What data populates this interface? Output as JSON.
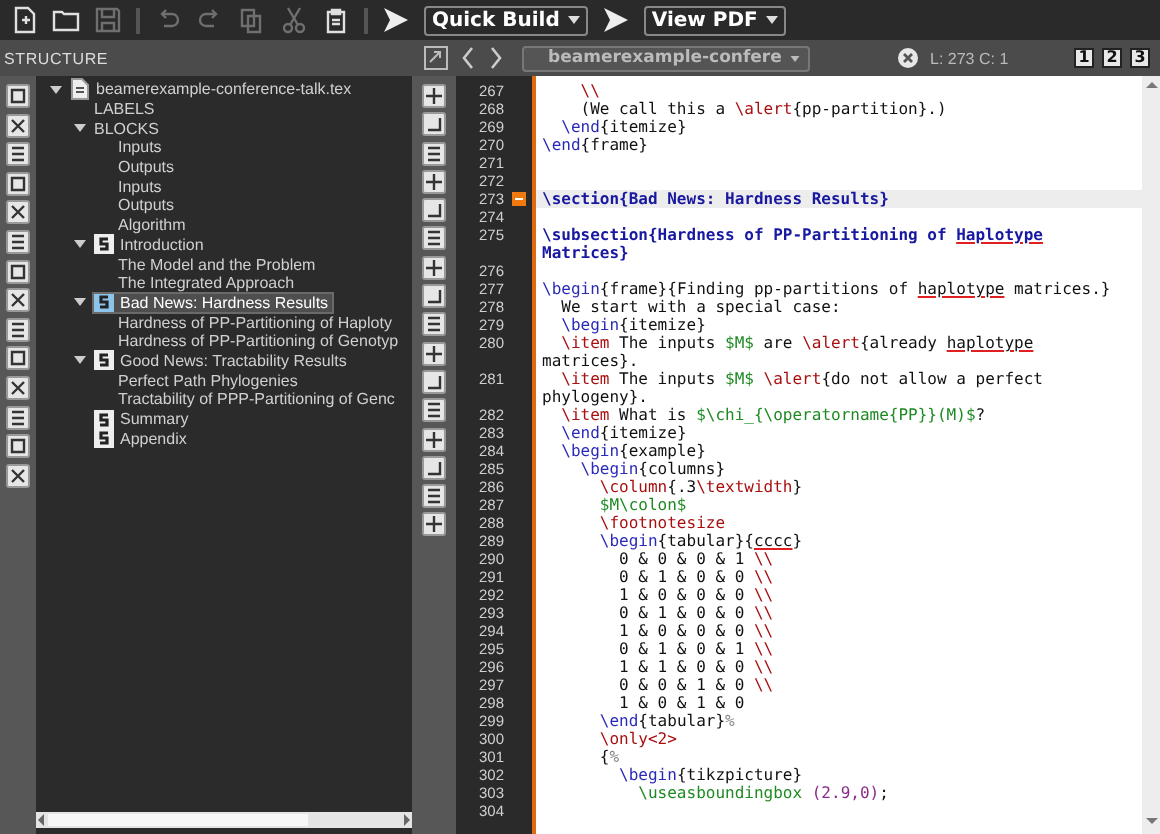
{
  "toolbar": {
    "buttons": [
      {
        "kind": "new",
        "disabled": false
      },
      {
        "kind": "open",
        "disabled": false
      },
      {
        "kind": "save",
        "disabled": true
      },
      {
        "kind": "separator"
      },
      {
        "kind": "undo",
        "disabled": true
      },
      {
        "kind": "redo",
        "disabled": true
      },
      {
        "kind": "copy",
        "disabled": true
      },
      {
        "kind": "cut",
        "disabled": true
      },
      {
        "kind": "paste",
        "disabled": false
      },
      {
        "kind": "separator"
      }
    ],
    "build": {
      "label": "Quick Build"
    },
    "view": {
      "label": "View PDF"
    }
  },
  "structure": {
    "title": "STRUCTURE",
    "tree": [
      {
        "label": "beamerexample-conference-talk.tex",
        "kind": "file",
        "expanded": true,
        "selected": false,
        "children": [
          {
            "label": "LABELS",
            "kind": "plain",
            "selected": false
          },
          {
            "label": "BLOCKS",
            "kind": "plain",
            "expanded": true,
            "selected": false,
            "children": [
              {
                "label": "Inputs",
                "kind": "plain",
                "selected": false
              },
              {
                "label": "Outputs",
                "kind": "plain",
                "selected": false
              },
              {
                "label": "Inputs",
                "kind": "plain",
                "selected": false
              },
              {
                "label": "Outputs",
                "kind": "plain",
                "selected": false
              },
              {
                "label": "Algorithm",
                "kind": "plain",
                "selected": false
              }
            ]
          },
          {
            "label": "Introduction",
            "kind": "section",
            "expanded": true,
            "selected": false,
            "children": [
              {
                "label": "The Model and the Problem",
                "kind": "plain",
                "selected": false
              },
              {
                "label": "The Integrated Approach",
                "kind": "plain",
                "selected": false
              }
            ]
          },
          {
            "label": "Bad News: Hardness Results",
            "kind": "section",
            "expanded": true,
            "selected": true,
            "children": [
              {
                "label": "Hardness of PP-Partitioning of Haploty",
                "kind": "plain",
                "selected": false
              },
              {
                "label": "Hardness of PP-Partitioning of Genotyp",
                "kind": "plain",
                "selected": false
              }
            ]
          },
          {
            "label": "Good News: Tractability Results",
            "kind": "section",
            "expanded": true,
            "selected": false,
            "children": [
              {
                "label": "Perfect Path Phylogenies",
                "kind": "plain",
                "selected": false
              },
              {
                "label": "Tractability of PPP-Partitioning of Genc",
                "kind": "plain",
                "selected": false
              }
            ]
          },
          {
            "label": "Summary",
            "kind": "section",
            "selected": false
          },
          {
            "label": "Appendix",
            "kind": "section",
            "selected": false
          }
        ]
      }
    ]
  },
  "editor": {
    "file_tab": "beamerexample-confere",
    "cursor": "L: 273 C: 1",
    "bookmarks": [
      "1",
      "2",
      "3"
    ],
    "lines": [
      {
        "number": "267",
        "current": false,
        "marker": false,
        "rows": [
          [
            {
              "kind": "cmd",
              "t": "    \\\\"
            }
          ]
        ]
      },
      {
        "number": "268",
        "current": false,
        "marker": false,
        "rows": [
          [
            {
              "kind": "t",
              "t": "    (We call this a "
            },
            {
              "kind": "cmd",
              "t": "\\alert"
            },
            {
              "kind": "t",
              "t": "{pp-partition}.)"
            }
          ]
        ]
      },
      {
        "number": "269",
        "current": false,
        "marker": false,
        "rows": [
          [
            {
              "kind": "env",
              "t": "  \\end"
            },
            {
              "kind": "t",
              "t": "{itemize}"
            }
          ]
        ]
      },
      {
        "number": "270",
        "current": false,
        "marker": false,
        "rows": [
          [
            {
              "kind": "env",
              "t": "\\end"
            },
            {
              "kind": "t",
              "t": "{frame}"
            }
          ]
        ]
      },
      {
        "number": "271",
        "current": false,
        "marker": false
      },
      {
        "number": "272",
        "current": false,
        "marker": false
      },
      {
        "number": "273",
        "current": true,
        "marker": true,
        "rows": [
          [
            {
              "kind": "sec",
              "t": "\\section{Bad News: Hardness Results}"
            }
          ]
        ]
      },
      {
        "number": "274",
        "current": false,
        "marker": false
      },
      {
        "number": "275",
        "current": false,
        "marker": false,
        "rows": [
          [
            {
              "kind": "sec",
              "t": "\\subsection{Hardness of PP-Partitioning of "
            },
            {
              "kind": "secspell",
              "t": "Haplotype"
            }
          ],
          [
            {
              "kind": "sec",
              "t": "Matrices}"
            }
          ]
        ]
      },
      {
        "number": "276",
        "current": false,
        "marker": false
      },
      {
        "number": "277",
        "current": false,
        "marker": false,
        "rows": [
          [
            {
              "kind": "env",
              "t": "\\begin"
            },
            {
              "kind": "t",
              "t": "{frame}{Finding pp-partitions of "
            },
            {
              "kind": "spell",
              "t": "haplotype"
            },
            {
              "kind": "t",
              "t": " matrices.}"
            }
          ]
        ]
      },
      {
        "number": "278",
        "current": false,
        "marker": false,
        "rows": [
          [
            {
              "kind": "t",
              "t": "  We start with a special case:"
            }
          ]
        ]
      },
      {
        "number": "279",
        "current": false,
        "marker": false,
        "rows": [
          [
            {
              "kind": "env",
              "t": "  \\begin"
            },
            {
              "kind": "t",
              "t": "{itemize}"
            }
          ]
        ]
      },
      {
        "number": "280",
        "current": false,
        "marker": false,
        "rows": [
          [
            {
              "kind": "cmd",
              "t": "  \\item"
            },
            {
              "kind": "t",
              "t": " The inputs "
            },
            {
              "kind": "math",
              "t": "$M$"
            },
            {
              "kind": "t",
              "t": " are "
            },
            {
              "kind": "cmd",
              "t": "\\alert"
            },
            {
              "kind": "t",
              "t": "{already "
            },
            {
              "kind": "spell",
              "t": "haplotype"
            }
          ],
          [
            {
              "kind": "t",
              "t": "matrices}."
            }
          ]
        ]
      },
      {
        "number": "281",
        "current": false,
        "marker": false,
        "rows": [
          [
            {
              "kind": "cmd",
              "t": "  \\item"
            },
            {
              "kind": "t",
              "t": " The inputs "
            },
            {
              "kind": "math",
              "t": "$M$"
            },
            {
              "kind": "cmd",
              "t": " \\alert"
            },
            {
              "kind": "t",
              "t": "{do not allow a perfect"
            }
          ],
          [
            {
              "kind": "t",
              "t": "phylogeny}."
            }
          ]
        ]
      },
      {
        "number": "282",
        "current": false,
        "marker": false,
        "rows": [
          [
            {
              "kind": "cmd",
              "t": "  \\item"
            },
            {
              "kind": "t",
              "t": " What is "
            },
            {
              "kind": "math",
              "t": "$\\chi_{\\operatorname{PP}}(M)$"
            },
            {
              "kind": "t",
              "t": "?"
            }
          ]
        ]
      },
      {
        "number": "283",
        "current": false,
        "marker": false,
        "rows": [
          [
            {
              "kind": "env",
              "t": "  \\end"
            },
            {
              "kind": "t",
              "t": "{itemize}"
            }
          ]
        ]
      },
      {
        "number": "284",
        "current": false,
        "marker": false,
        "rows": [
          [
            {
              "kind": "env",
              "t": "  \\begin"
            },
            {
              "kind": "t",
              "t": "{example}"
            }
          ]
        ]
      },
      {
        "number": "285",
        "current": false,
        "marker": false,
        "rows": [
          [
            {
              "kind": "env",
              "t": "    \\begin"
            },
            {
              "kind": "t",
              "t": "{columns}"
            }
          ]
        ]
      },
      {
        "number": "286",
        "current": false,
        "marker": false,
        "rows": [
          [
            {
              "kind": "cmd",
              "t": "      \\column"
            },
            {
              "kind": "t",
              "t": "{.3"
            },
            {
              "kind": "cmd",
              "t": "\\textwidth"
            },
            {
              "kind": "t",
              "t": "}"
            }
          ]
        ]
      },
      {
        "number": "287",
        "current": false,
        "marker": false,
        "rows": [
          [
            {
              "kind": "math",
              "t": "      $M\\colon$"
            }
          ]
        ]
      },
      {
        "number": "288",
        "current": false,
        "marker": false,
        "rows": [
          [
            {
              "kind": "cmd",
              "t": "      \\footnotesize"
            }
          ]
        ]
      },
      {
        "number": "289",
        "current": false,
        "marker": false,
        "rows": [
          [
            {
              "kind": "env",
              "t": "      \\begin"
            },
            {
              "kind": "t",
              "t": "{tabular}{"
            },
            {
              "kind": "spell",
              "t": "cccc"
            },
            {
              "kind": "t",
              "t": "}"
            }
          ]
        ]
      },
      {
        "number": "290",
        "current": false,
        "marker": false,
        "rows": [
          [
            {
              "kind": "t",
              "t": "        0 & 0 & 0 & 1 "
            },
            {
              "kind": "cmd",
              "t": "\\\\"
            }
          ]
        ]
      },
      {
        "number": "291",
        "current": false,
        "marker": false,
        "rows": [
          [
            {
              "kind": "t",
              "t": "        0 & 1 & 0 & 0 "
            },
            {
              "kind": "cmd",
              "t": "\\\\"
            }
          ]
        ]
      },
      {
        "number": "292",
        "current": false,
        "marker": false,
        "rows": [
          [
            {
              "kind": "t",
              "t": "        1 & 0 & 0 & 0 "
            },
            {
              "kind": "cmd",
              "t": "\\\\"
            }
          ]
        ]
      },
      {
        "number": "293",
        "current": false,
        "marker": false,
        "rows": [
          [
            {
              "kind": "t",
              "t": "        0 & 1 & 0 & 0 "
            },
            {
              "kind": "cmd",
              "t": "\\\\"
            }
          ]
        ]
      },
      {
        "number": "294",
        "current": false,
        "marker": false,
        "rows": [
          [
            {
              "kind": "t",
              "t": "        1 & 0 & 0 & 0 "
            },
            {
              "kind": "cmd",
              "t": "\\\\"
            }
          ]
        ]
      },
      {
        "number": "295",
        "current": false,
        "marker": false,
        "rows": [
          [
            {
              "kind": "t",
              "t": "        0 & 1 & 0 & 1 "
            },
            {
              "kind": "cmd",
              "t": "\\\\"
            }
          ]
        ]
      },
      {
        "number": "296",
        "current": false,
        "marker": false,
        "rows": [
          [
            {
              "kind": "t",
              "t": "        1 & 1 & 0 & 0 "
            },
            {
              "kind": "cmd",
              "t": "\\\\"
            }
          ]
        ]
      },
      {
        "number": "297",
        "current": false,
        "marker": false,
        "rows": [
          [
            {
              "kind": "t",
              "t": "        0 & 0 & 1 & 0 "
            },
            {
              "kind": "cmd",
              "t": "\\\\"
            }
          ]
        ]
      },
      {
        "number": "298",
        "current": false,
        "marker": false,
        "rows": [
          [
            {
              "kind": "t",
              "t": "        1 & 0 & 1 & 0"
            }
          ]
        ]
      },
      {
        "number": "299",
        "current": false,
        "marker": false,
        "rows": [
          [
            {
              "kind": "env",
              "t": "      \\end"
            },
            {
              "kind": "t",
              "t": "{tabular}"
            },
            {
              "kind": "cmt",
              "t": "%"
            }
          ]
        ]
      },
      {
        "number": "300",
        "current": false,
        "marker": false,
        "rows": [
          [
            {
              "kind": "cmd",
              "t": "      \\only"
            },
            {
              "kind": "cmd",
              "t": "<2>"
            }
          ]
        ]
      },
      {
        "number": "301",
        "current": false,
        "marker": false,
        "rows": [
          [
            {
              "kind": "t",
              "t": "      {"
            },
            {
              "kind": "cmt",
              "t": "%"
            }
          ]
        ]
      },
      {
        "number": "302",
        "current": false,
        "marker": false,
        "rows": [
          [
            {
              "kind": "env",
              "t": "        \\begin"
            },
            {
              "kind": "t",
              "t": "{tikzpicture}"
            }
          ]
        ]
      },
      {
        "number": "303",
        "current": false,
        "marker": false,
        "rows": [
          [
            {
              "kind": "math",
              "t": "          \\useasboundingbox"
            },
            {
              "kind": "num",
              "t": " (2.9,0)"
            },
            {
              "kind": "t",
              "t": ";"
            }
          ]
        ]
      },
      {
        "number": "304",
        "current": false,
        "marker": false
      }
    ]
  }
}
